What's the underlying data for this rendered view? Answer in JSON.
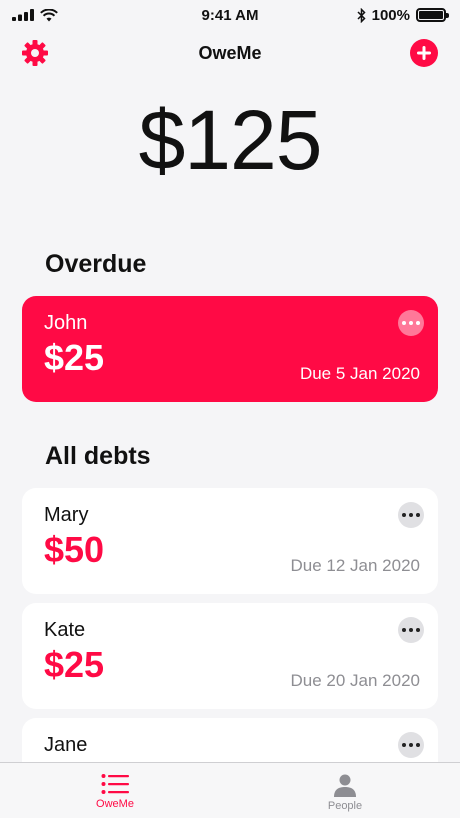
{
  "status_bar": {
    "time": "9:41 AM",
    "battery_text": "100%",
    "battery_level": 1.0
  },
  "nav": {
    "title": "OweMe",
    "left_icon": "gear-icon",
    "right_icon": "plus-circle-icon"
  },
  "total": "$125",
  "overdue": {
    "title": "Overdue",
    "items": [
      {
        "name": "John",
        "amount": "$25",
        "due": "Due 5 Jan 2020"
      }
    ]
  },
  "all_debts": {
    "title": "All debts",
    "items": [
      {
        "name": "Mary",
        "amount": "$50",
        "due": "Due 12 Jan 2020"
      },
      {
        "name": "Kate",
        "amount": "$25",
        "due": "Due 20 Jan 2020"
      },
      {
        "name": "Jane",
        "amount": "",
        "due": ""
      }
    ]
  },
  "tabs": [
    {
      "label": "OweMe",
      "icon": "list-icon",
      "active": true
    },
    {
      "label": "People",
      "icon": "person-icon",
      "active": false
    }
  ],
  "colors": {
    "accent": "#ff0a45",
    "background": "#f5f5f7",
    "card": "#ffffff",
    "secondary_text": "#8e8e93"
  }
}
